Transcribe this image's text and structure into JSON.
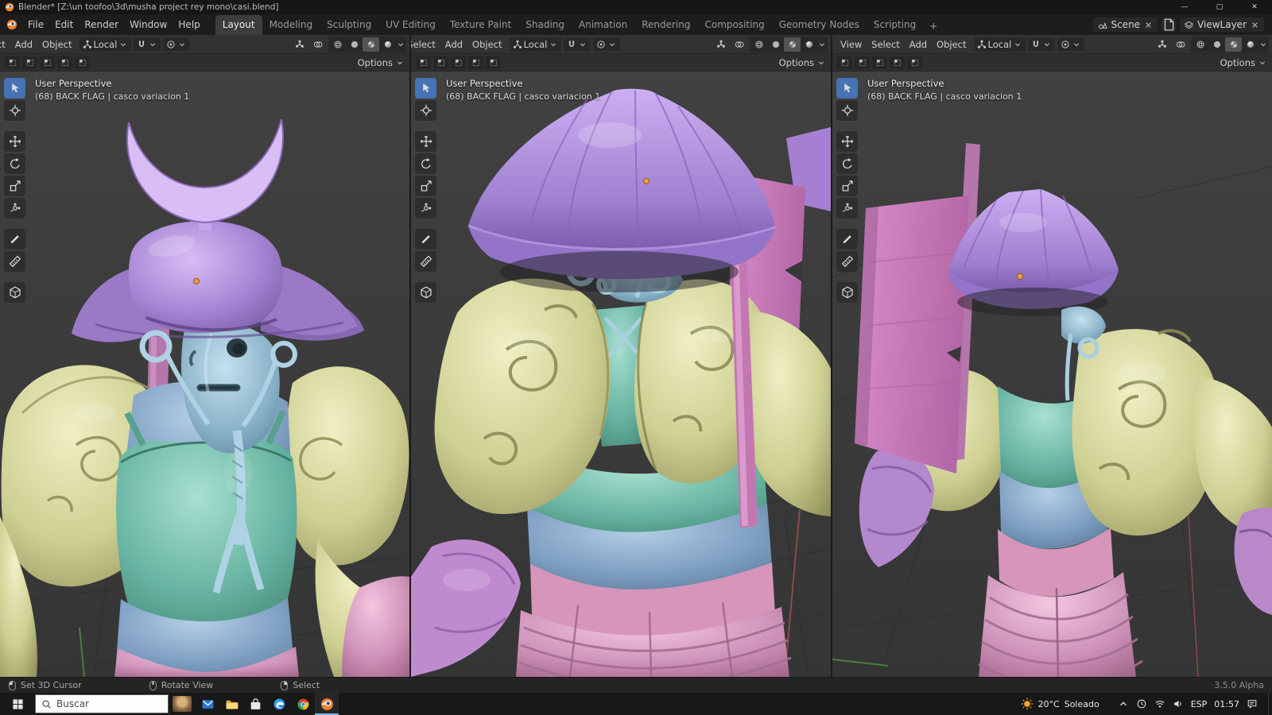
{
  "window": {
    "title": "Blender* [Z:\\un toofoo\\3d\\musha project rey mono\\casi.blend]",
    "controls": {
      "minimize": "—",
      "maximize": "▢",
      "close": "✕"
    }
  },
  "topbar": {
    "menus": [
      "File",
      "Edit",
      "Render",
      "Window",
      "Help"
    ],
    "workspaces": [
      "Layout",
      "Modeling",
      "Sculpting",
      "UV Editing",
      "Texture Paint",
      "Shading",
      "Animation",
      "Rendering",
      "Compositing",
      "Geometry Nodes",
      "Scripting"
    ],
    "active_workspace": "Layout",
    "add_workspace_label": "+",
    "scene": {
      "label": "Scene",
      "unlink": "✕"
    },
    "viewlayer": {
      "label": "ViewLayer",
      "unlink": "✕"
    }
  },
  "viewport": {
    "menus": [
      "View",
      "Select",
      "Add",
      "Object"
    ],
    "orientation": "Local",
    "options_label": "Options",
    "overlay_line1": "User Perspective",
    "overlay_line2": "(68) BACK FLAG | casco variacion 1",
    "tools": [
      "select-box",
      "cursor",
      "move",
      "rotate",
      "scale",
      "transform",
      "annotate",
      "measure",
      "add-cube"
    ],
    "shading_modes": [
      "wireframe",
      "solid",
      "material-preview",
      "rendered"
    ],
    "active_shading": "material-preview"
  },
  "statusbar": {
    "hints": [
      {
        "label": "Set 3D Cursor"
      },
      {
        "label": "Rotate View"
      },
      {
        "label": "Select"
      }
    ],
    "version": "3.5.0 Alpha"
  },
  "taskbar": {
    "search_placeholder": "Buscar",
    "apps": [
      "mail",
      "file-explorer",
      "store",
      "edge",
      "chrome",
      "blender"
    ],
    "weather_temp": "20°C",
    "weather_condition": "Soleado",
    "language": "ESP",
    "time": "01:57"
  },
  "colors": {
    "accent_blue": "#4772b3",
    "blender_orange": "#f0812c",
    "matcap_purple": "#a584d4",
    "matcap_yellow": "#cecf92",
    "matcap_teal": "#68b4a2",
    "matcap_blue": "#8cb4ca",
    "matcap_pink": "#d094ba"
  }
}
